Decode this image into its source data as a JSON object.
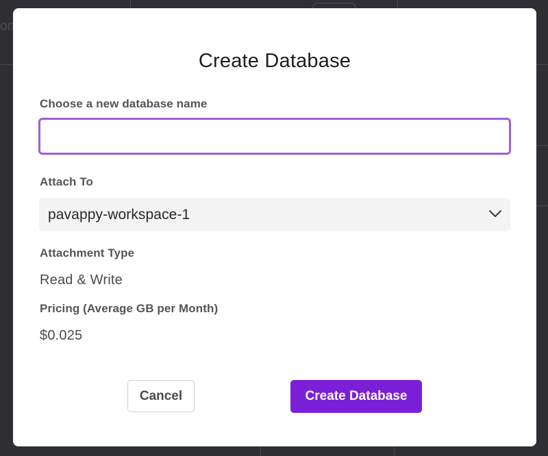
{
  "background": {
    "partial_text": "on"
  },
  "dialog": {
    "title": "Create Database",
    "name_field": {
      "label": "Choose a new database name",
      "value": "",
      "placeholder": ""
    },
    "attach_to": {
      "label": "Attach To",
      "selected": "pavappy-workspace-1"
    },
    "attachment_type": {
      "label": "Attachment Type",
      "value": "Read & Write"
    },
    "pricing": {
      "label": "Pricing (Average GB per Month)",
      "value": "$0.025"
    },
    "buttons": {
      "cancel": "Cancel",
      "create": "Create Database"
    },
    "colors": {
      "accent": "#7b1fd8",
      "focus_border": "#a35cd8",
      "backdrop": "#2f2f33"
    }
  }
}
